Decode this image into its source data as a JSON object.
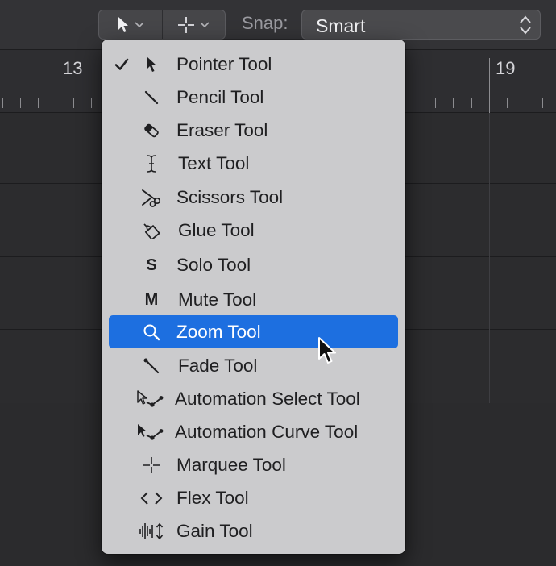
{
  "toolbar": {
    "left_tool": "pointer-icon",
    "right_tool": "marquee-icon",
    "snap_label": "Snap:",
    "snap_value": "Smart"
  },
  "ruler": {
    "markers": [
      "13",
      "19"
    ]
  },
  "tool_menu": {
    "selected_index": 8,
    "checked_index": 0,
    "highlight_color": "#1d6fe0",
    "items": [
      {
        "label": "Pointer Tool",
        "icon": "pointer-icon"
      },
      {
        "label": "Pencil Tool",
        "icon": "pencil-icon"
      },
      {
        "label": "Eraser Tool",
        "icon": "eraser-icon"
      },
      {
        "label": "Text Tool",
        "icon": "text-cursor-icon"
      },
      {
        "label": "Scissors Tool",
        "icon": "scissors-icon"
      },
      {
        "label": "Glue Tool",
        "icon": "glue-icon"
      },
      {
        "label": "Solo Tool",
        "icon": "solo-icon",
        "glyph": "S"
      },
      {
        "label": "Mute Tool",
        "icon": "mute-icon",
        "glyph": "M"
      },
      {
        "label": "Zoom Tool",
        "icon": "magnifier-icon"
      },
      {
        "label": "Fade Tool",
        "icon": "fade-icon"
      },
      {
        "label": "Automation Select Tool",
        "icon": "automation-select-icon"
      },
      {
        "label": "Automation Curve Tool",
        "icon": "automation-curve-icon"
      },
      {
        "label": "Marquee Tool",
        "icon": "marquee-icon"
      },
      {
        "label": "Flex Tool",
        "icon": "flex-icon"
      },
      {
        "label": "Gain Tool",
        "icon": "gain-icon"
      }
    ]
  }
}
